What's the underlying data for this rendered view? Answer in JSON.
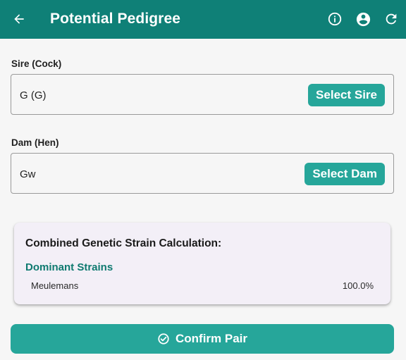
{
  "appbar": {
    "title": "Potential Pedigree",
    "background": "#0f8077",
    "icons": [
      "back-arrow-icon",
      "info-icon",
      "account-circle-icon",
      "refresh-icon"
    ]
  },
  "sire": {
    "label": "Sire (Cock)",
    "value": "G (G)",
    "button": "Select Sire"
  },
  "dam": {
    "label": "Dam (Hen)",
    "value": "Gw",
    "button": "Select Dam"
  },
  "strain_card": {
    "heading": "Combined Genetic Strain Calculation:",
    "section": "Dominant Strains",
    "rows": [
      {
        "name": "Meulemans",
        "percent": "100.0%"
      }
    ]
  },
  "confirm": {
    "label": "Confirm Pair",
    "icon": "check-circle-icon"
  },
  "colors": {
    "accent": "#26a69a",
    "strain_heading": "#0f7a70",
    "card_bg": "#f3eff7"
  }
}
